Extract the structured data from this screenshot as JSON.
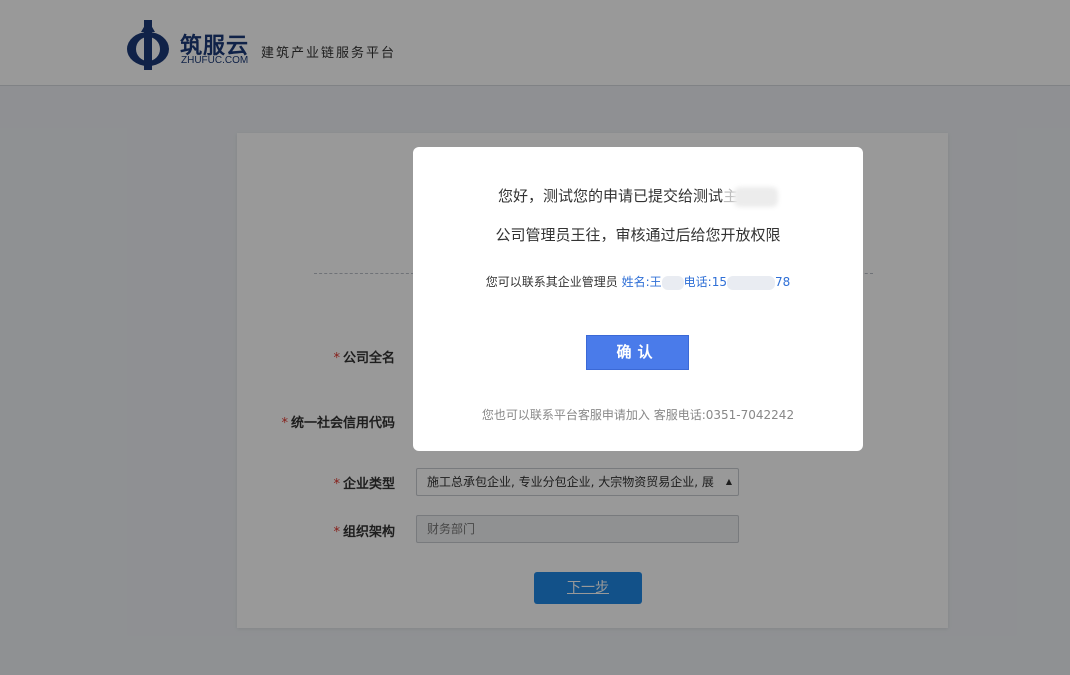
{
  "header": {
    "logo_name": "筑服云",
    "logo_domain": "ZHUFUC.COM",
    "slogan": "建筑产业链服务平台"
  },
  "form": {
    "company_name_label": "公司全名",
    "credit_code_label": "统一社会信用代码",
    "enterprise_type_label": "企业类型",
    "enterprise_type_value": "施工总承包企业, 专业分包企业, 大宗物资贸易企业, 展",
    "org_label": "组织架构",
    "org_value": "财务部门",
    "required_mark": "*",
    "next_label": "下一步"
  },
  "modal": {
    "line1": "您好，测试您的申请已提交给测试",
    "line1_tail": "主",
    "line2": "公司管理员王往，审核通过后给您开放权限",
    "contact_prefix": "您可以联系其企业管理员",
    "contact_name_label": "姓名:",
    "contact_name_partial": "王",
    "contact_phone_label": "电话:",
    "contact_phone_start": "15",
    "contact_phone_end": "78",
    "confirm_label": "确认",
    "footer": "您也可以联系平台客服申请加入 客服电话:0351-7042242"
  },
  "colors": {
    "brand": "#1b3a78",
    "primary_button": "#1e88e5",
    "confirm_button": "#4a7bea",
    "link": "#2f6fd6",
    "required": "#e0322b"
  }
}
